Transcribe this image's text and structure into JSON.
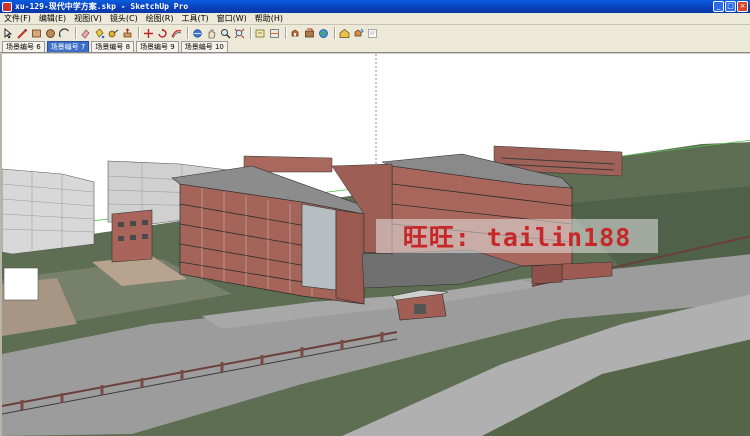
{
  "window": {
    "title": "xu-129-现代中学方案.skp - SketchUp Pro",
    "minimize": "_",
    "maximize": "□",
    "close": "×"
  },
  "menu": {
    "items": [
      "文件(F)",
      "编辑(E)",
      "视图(V)",
      "镜头(C)",
      "绘图(R)",
      "工具(T)",
      "窗口(W)",
      "帮助(H)"
    ]
  },
  "toolbar": {
    "tools": [
      "select-icon",
      "pencil-line-icon",
      "rectangle-icon",
      "circle-icon",
      "arc-icon",
      "eraser-icon",
      "paint-bucket-icon",
      "tape-measure-icon",
      "push-pull-icon",
      "move-icon",
      "rotate-icon",
      "offset-icon",
      "orbit-icon",
      "pan-icon",
      "zoom-icon",
      "zoom-extents-icon",
      "walk-icon",
      "section-icon",
      "components-icon",
      "materials-icon",
      "geo-location-icon",
      "warehouse-icon",
      "share-icon",
      "layout-icon"
    ]
  },
  "scene_tabs": {
    "items": [
      "场景编号 6",
      "场景编号 7",
      "场景编号 8",
      "场景编号 9",
      "场景编号 10"
    ],
    "active_index": 1
  },
  "watermark": {
    "text": "旺旺: tailin188"
  },
  "colors": {
    "titlebar": "#0a4fc8",
    "chrome": "#ece9d8",
    "ground": "#5c6e52",
    "road": "#9a9a9a",
    "brick": "#a8645a",
    "sky": "#ffffff",
    "watermark_text": "#c8272a"
  }
}
